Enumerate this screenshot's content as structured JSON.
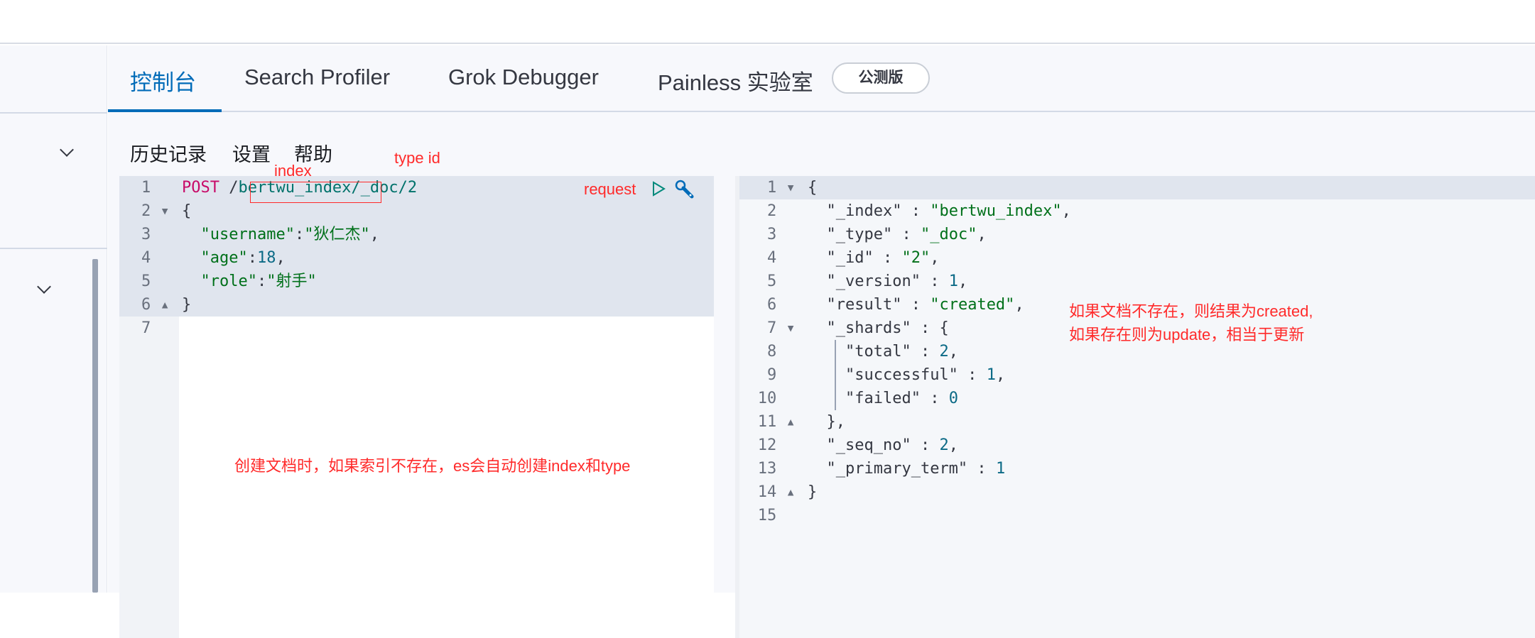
{
  "tabs": [
    {
      "label": "控制台",
      "active": true
    },
    {
      "label": "Search Profiler"
    },
    {
      "label": "Grok Debugger"
    },
    {
      "label": "Painless 实验室"
    }
  ],
  "badge": "公测版",
  "toolbar": [
    "历史记录",
    "设置",
    "帮助"
  ],
  "request": {
    "lines": [
      [
        [
          "k",
          "POST"
        ],
        [
          "t",
          " /"
        ],
        [
          "p",
          "bertwu_index/_doc/2"
        ]
      ],
      [
        [
          "t",
          "{"
        ]
      ],
      [
        [
          "t",
          "  "
        ],
        [
          "s",
          "\"username\""
        ],
        [
          "t",
          ":"
        ],
        [
          "s",
          "\"狄仁杰\""
        ],
        [
          "t",
          ","
        ]
      ],
      [
        [
          "t",
          "  "
        ],
        [
          "s",
          "\"age\""
        ],
        [
          "t",
          ":"
        ],
        [
          "n",
          "18"
        ],
        [
          "t",
          ","
        ]
      ],
      [
        [
          "t",
          "  "
        ],
        [
          "s",
          "\"role\""
        ],
        [
          "t",
          ":"
        ],
        [
          "s",
          "\"射手\""
        ]
      ],
      [
        [
          "t",
          "}"
        ]
      ],
      []
    ],
    "folds": [
      "",
      "▾",
      "",
      "",
      "",
      "▴",
      ""
    ]
  },
  "response": {
    "lines": [
      [
        [
          "t",
          "{"
        ]
      ],
      [
        [
          "t",
          "  "
        ],
        [
          "t",
          "\"_index\""
        ],
        [
          "t",
          " : "
        ],
        [
          "s",
          "\"bertwu_index\""
        ],
        [
          "t",
          ","
        ]
      ],
      [
        [
          "t",
          "  "
        ],
        [
          "t",
          "\"_type\""
        ],
        [
          "t",
          " : "
        ],
        [
          "s",
          "\"_doc\""
        ],
        [
          "t",
          ","
        ]
      ],
      [
        [
          "t",
          "  "
        ],
        [
          "t",
          "\"_id\""
        ],
        [
          "t",
          " : "
        ],
        [
          "s",
          "\"2\""
        ],
        [
          "t",
          ","
        ]
      ],
      [
        [
          "t",
          "  "
        ],
        [
          "t",
          "\"_version\""
        ],
        [
          "t",
          " : "
        ],
        [
          "n",
          "1"
        ],
        [
          "t",
          ","
        ]
      ],
      [
        [
          "t",
          "  "
        ],
        [
          "t",
          "\"result\""
        ],
        [
          "t",
          " : "
        ],
        [
          "s",
          "\"created\""
        ],
        [
          "t",
          ","
        ]
      ],
      [
        [
          "t",
          "  "
        ],
        [
          "t",
          "\"_shards\""
        ],
        [
          "t",
          " : {"
        ]
      ],
      [
        [
          "t",
          "    "
        ],
        [
          "t",
          "\"total\""
        ],
        [
          "t",
          " : "
        ],
        [
          "n",
          "2"
        ],
        [
          "t",
          ","
        ]
      ],
      [
        [
          "t",
          "    "
        ],
        [
          "t",
          "\"successful\""
        ],
        [
          "t",
          " : "
        ],
        [
          "n",
          "1"
        ],
        [
          "t",
          ","
        ]
      ],
      [
        [
          "t",
          "    "
        ],
        [
          "t",
          "\"failed\""
        ],
        [
          "t",
          " : "
        ],
        [
          "n",
          "0"
        ]
      ],
      [
        [
          "t",
          "  },"
        ]
      ],
      [
        [
          "t",
          "  "
        ],
        [
          "t",
          "\"_seq_no\""
        ],
        [
          "t",
          " : "
        ],
        [
          "n",
          "2"
        ],
        [
          "t",
          ","
        ]
      ],
      [
        [
          "t",
          "  "
        ],
        [
          "t",
          "\"_primary_term\""
        ],
        [
          "t",
          " : "
        ],
        [
          "n",
          "1"
        ]
      ],
      [
        [
          "t",
          "}"
        ]
      ],
      []
    ],
    "folds": [
      "▾",
      "",
      "",
      "",
      "",
      "",
      "▾",
      "",
      "",
      "",
      "▴",
      "",
      "",
      "▴",
      ""
    ]
  },
  "annotations": {
    "index": "index",
    "type_id": "type  id",
    "request": "request",
    "auto_create": "创建文档时，如果索引不存在，es会自动创建index和type",
    "result_line1": "如果文档不存在，则结果为created,",
    "result_line2": "如果存在则为update，相当于更新"
  },
  "icons": {
    "run": "play-icon",
    "settings": "wrench-icon"
  }
}
